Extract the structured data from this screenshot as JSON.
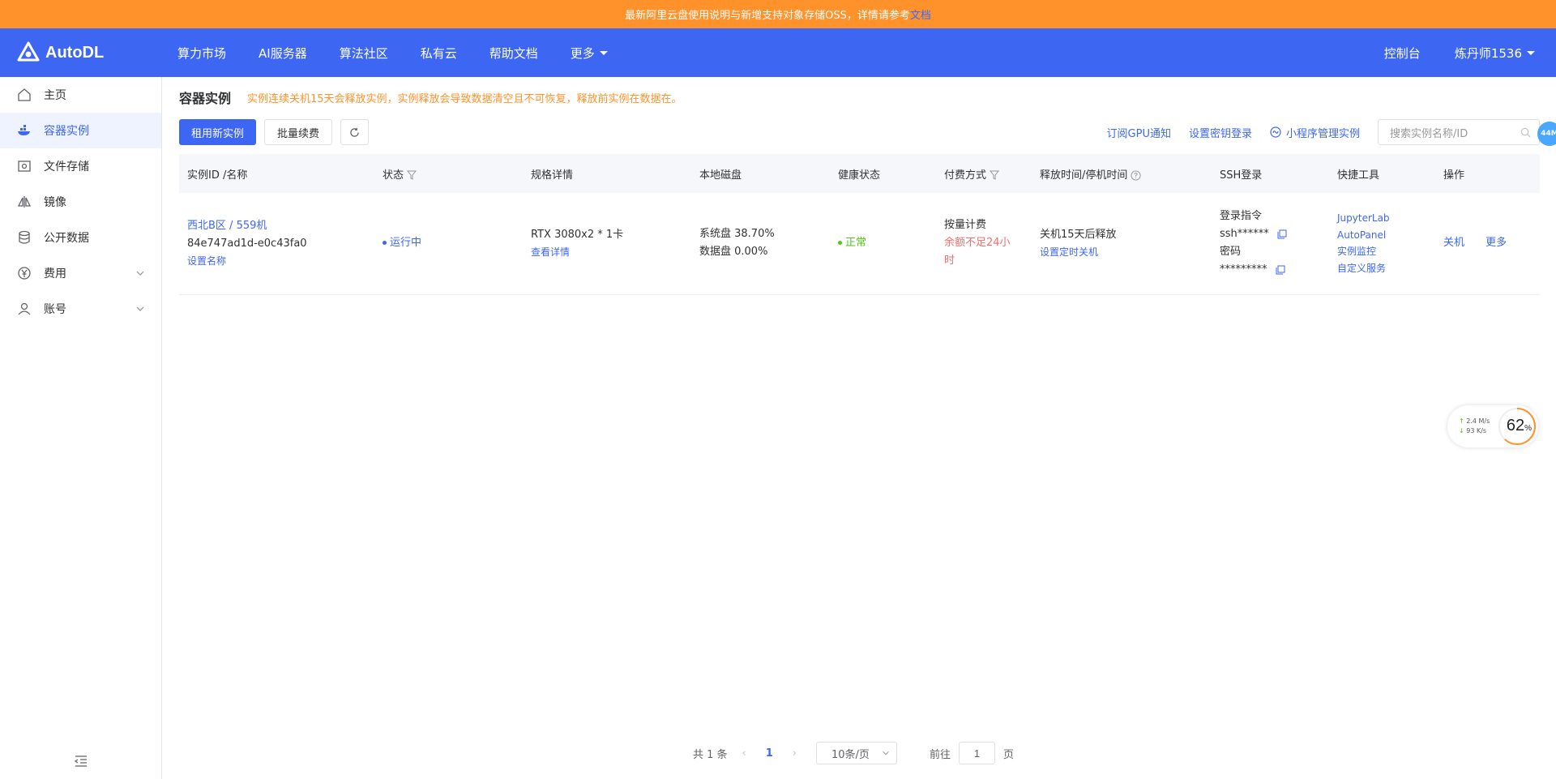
{
  "banner": {
    "text": "最新阿里云盘使用说明与新增支持对象存储OSS，详情请参考",
    "link": "文档"
  },
  "nav": {
    "logo": "AutoDL",
    "links": [
      "算力市场",
      "AI服务器",
      "算法社区",
      "私有云",
      "帮助文档",
      "更多"
    ],
    "console": "控制台",
    "user": "炼丹师1536"
  },
  "sidebar": {
    "items": [
      {
        "label": "主页",
        "icon": "home-icon"
      },
      {
        "label": "容器实例",
        "icon": "container-icon"
      },
      {
        "label": "文件存储",
        "icon": "storage-icon"
      },
      {
        "label": "镜像",
        "icon": "image-icon"
      },
      {
        "label": "公开数据",
        "icon": "database-icon"
      },
      {
        "label": "费用",
        "icon": "yen-icon"
      },
      {
        "label": "账号",
        "icon": "user-icon"
      }
    ],
    "active": "容器实例"
  },
  "page": {
    "title": "容器实例",
    "warning": "实例连续关机15天会释放实例，实例释放会导致数据清空且不可恢复，释放前实例在数据在。"
  },
  "toolbar": {
    "new_instance": "租用新实例",
    "batch_renew": "批量续费",
    "subscribe_gpu": "订阅GPU通知",
    "set_key_login": "设置密钥登录",
    "miniprogram": "小程序管理实例",
    "search_placeholder": "搜索实例名称/ID",
    "badge": "44M"
  },
  "table": {
    "headers": [
      "实例ID /名称",
      "状态",
      "规格详情",
      "本地磁盘",
      "健康状态",
      "付费方式",
      "释放时间/停机时间",
      "SSH登录",
      "快捷工具",
      "操作"
    ],
    "row": {
      "region": "西北B区 / 559机",
      "id": "84e747ad1d-e0c43fa0",
      "set_name": "设置名称",
      "status": "运行中",
      "spec": "RTX 3080x2 * 1卡",
      "view_detail": "查看详情",
      "system_disk": "系统盘 38.70%",
      "data_disk": "数据盘 0.00%",
      "health": "正常",
      "billing": "按量计费",
      "balance_warn": "余额不足24小时",
      "release": "关机15天后释放",
      "set_timer": "设置定时关机",
      "ssh_cmd_label": "登录指令",
      "ssh_cmd": "ssh******",
      "pwd_label": "密码",
      "pwd": "*********",
      "tools": [
        "JupyterLab",
        "AutoPanel",
        "实例监控",
        "自定义服务"
      ],
      "shutdown": "关机",
      "more": "更多"
    }
  },
  "pager": {
    "total": "共 1 条",
    "current": "1",
    "page_size": "10条/页",
    "goto": "前往",
    "goto_value": "1",
    "page_unit": "页"
  },
  "speed": {
    "up": "2.4",
    "up_unit": "M/s",
    "down": "93",
    "down_unit": "K/s",
    "percent": "62",
    "percent_sign": "%"
  },
  "colors": {
    "primary": "#3d66f2",
    "banner": "#ff922b",
    "danger": "#f56c6c",
    "success": "#52c41a"
  }
}
